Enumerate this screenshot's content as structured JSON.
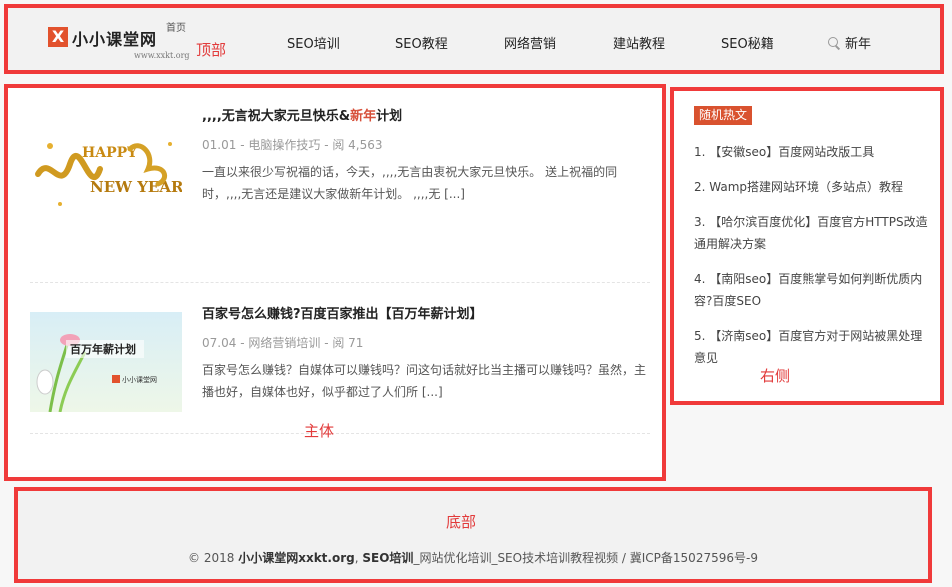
{
  "header": {
    "logo_title": "小小课堂网",
    "logo_x": "X",
    "logo_home": "首页",
    "logo_url": "www.xxkt.org",
    "region_label": "顶部",
    "nav": [
      "SEO培训",
      "SEO教程",
      "网络营销",
      "建站教程",
      "SEO秘籍"
    ],
    "search_text": "新年"
  },
  "main": {
    "region_label": "主体",
    "posts": [
      {
        "title_prefix": ",,,,无言祝大家元旦快乐&",
        "title_highlight": "新年",
        "title_suffix": "计划",
        "date": "01.01",
        "category": "电脑操作技巧",
        "views": "阅 4,563",
        "excerpt": "一直以来很少写祝福的话，今天，,,,,无言由衷祝大家元旦快乐。 送上祝福的同时，,,,,无言还是建议大家做新年计划。 ,,,,无",
        "more": "[...]",
        "thumb_text": "HAPPY NEW YEAR"
      },
      {
        "title_prefix": "百家号怎么赚钱?百度百家推出【百万年薪计划】",
        "title_highlight": "",
        "title_suffix": "",
        "date": "07.04",
        "category": "网络营销培训",
        "views": "阅 71",
        "excerpt": "百家号怎么赚钱？自媒体可以赚钱吗？问这句话就好比当主播可以赚钱吗？虽然，主播也好，自媒体也好，似乎都过了人们所",
        "more": "[...]",
        "thumb_text": "百万年薪计划",
        "thumb_sub": "小小课堂网"
      }
    ]
  },
  "sidebar": {
    "region_label": "右侧",
    "badge": "随机热文",
    "items": [
      "1. 【安徽seo】百度网站改版工具",
      "2. Wamp搭建网站环境（多站点）教程",
      "3. 【哈尔滨百度优化】百度官方HTTPS改造通用解决方案",
      "4. 【南阳seo】百度熊掌号如何判断优质内容?百度SEO",
      "5. 【济南seo】百度官方对于网站被黑处理意见"
    ]
  },
  "footer": {
    "region_label": "底部",
    "copyright": "© 2018",
    "site": "小小课堂网xxkt.org",
    "sep": ",",
    "link": "SEO培训",
    "tail": "_网站优化培训_SEO技术培训教程视频 / 冀ICP备15027596号-9"
  },
  "colors": {
    "annotation_red": "#f03a3a",
    "accent": "#d9522f"
  }
}
